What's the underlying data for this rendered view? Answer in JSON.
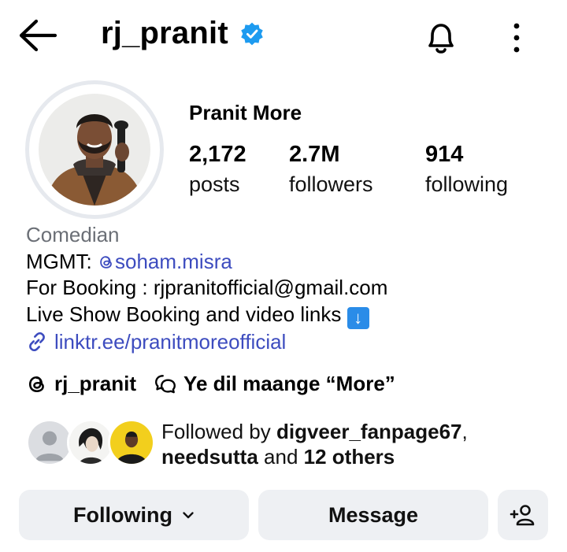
{
  "header": {
    "handle": "rj_pranit",
    "back_icon": "arrow-left-icon",
    "verified_icon": "verified-badge-icon",
    "notifications_icon": "bell-icon",
    "menu_icon": "more-vertical-icon"
  },
  "profile": {
    "full_name": "Pranit More",
    "stats": [
      {
        "value": "2,172",
        "label": "posts"
      },
      {
        "value": "2.7M",
        "label": "followers"
      },
      {
        "value": "914",
        "label": "following"
      }
    ]
  },
  "bio": {
    "category": "Comedian",
    "mgmt_prefix": "MGMT: ",
    "mgmt_handle": "soham.misra",
    "booking": "For Booking : rjpranitofficial@gmail.com",
    "live_show": "Live Show Booking and video links",
    "link": "linktr.ee/pranitmoreofficial"
  },
  "threads": {
    "handle": "rj_pranit",
    "note": "Ye dil maange “More”"
  },
  "followed_by": {
    "prefix": "Followed by ",
    "user1": "digveer_fanpage67",
    "comma": ",",
    "user2": "needsutta",
    "and": " and ",
    "others": "12 others"
  },
  "actions": {
    "following_label": "Following",
    "message_label": "Message"
  },
  "colors": {
    "link": "#3d4cbf",
    "verified": "#1d9bf0",
    "button_bg": "#eef0f3",
    "category": "#6b6f76"
  }
}
